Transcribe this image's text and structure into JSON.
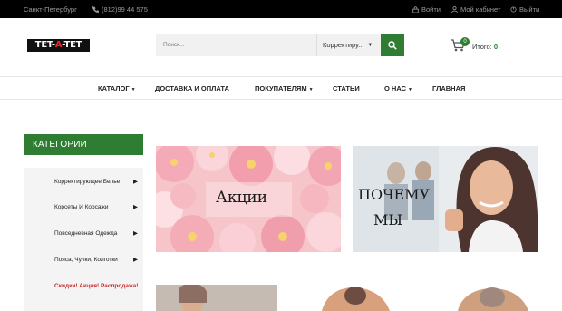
{
  "topbar": {
    "city": "Санкт-Петербург",
    "phone": "(812)99 44 575",
    "login": "Войти",
    "cabinet": "Мой кабинет",
    "logout": "Выйти"
  },
  "header": {
    "logo_left": "TET-",
    "logo_mid": "A",
    "logo_right": "-TET",
    "search_placeholder": "Поиск...",
    "search_category": "Корректиру...",
    "cart_count": "0",
    "cart_label": "Итого:",
    "cart_sum": "0"
  },
  "nav": {
    "items": [
      {
        "label": "КАТАЛОГ"
      },
      {
        "label": "ДОСТАВКА И ОПЛАТА"
      },
      {
        "label": "ПОКУПАТЕЛЯМ"
      },
      {
        "label": "СТАТЬИ"
      },
      {
        "label": "О НАС"
      },
      {
        "label": "ГЛАВНАЯ"
      }
    ]
  },
  "sidebar": {
    "title": "КАТЕГОРИИ",
    "items": [
      {
        "label": "Корректирующее Белье"
      },
      {
        "label": "Корсеты И Корсажи"
      },
      {
        "label": "Повседневная Одежда"
      },
      {
        "label": "Пояса, Чулки, Колготки"
      },
      {
        "label": "Скидки! Акция! Распродажа!"
      }
    ]
  },
  "banners": {
    "promo": "Акции",
    "why_line1": "ПОЧЕМУ",
    "why_line2": "МЫ"
  },
  "colors": {
    "accent_green": "#2e7d32",
    "topbar_bg": "#000000",
    "promo_pink": "#f7c9cd"
  }
}
